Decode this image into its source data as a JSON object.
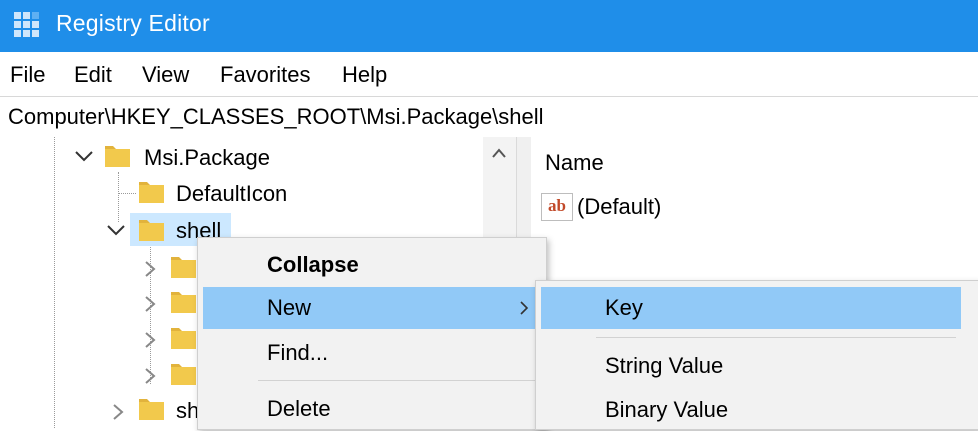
{
  "window": {
    "title": "Registry Editor",
    "icon": "registry-icon"
  },
  "menu": {
    "items": [
      "File",
      "Edit",
      "View",
      "Favorites",
      "Help"
    ]
  },
  "address": {
    "path": "Computer\\HKEY_CLASSES_ROOT\\Msi.Package\\shell"
  },
  "tree": {
    "nodes": [
      {
        "label": "Msi.Package",
        "expanded": true
      },
      {
        "label": "DefaultIcon",
        "expanded": false
      },
      {
        "label": "shell",
        "expanded": true,
        "selected": true
      },
      {
        "label": "",
        "expanded": false
      },
      {
        "label": "",
        "expanded": false
      },
      {
        "label": "",
        "expanded": false
      },
      {
        "label": "",
        "expanded": false
      },
      {
        "label": "sh",
        "expanded": false
      }
    ]
  },
  "values_pane": {
    "column_name": "Name",
    "rows": [
      {
        "icon": "ab-string-icon",
        "name": "(Default)"
      }
    ]
  },
  "context_menu": {
    "items": [
      {
        "label": "Collapse",
        "bold": true
      },
      {
        "label": "New",
        "submenu": true,
        "highlighted": true
      },
      {
        "label": "Find..."
      },
      {
        "label": "Delete"
      }
    ]
  },
  "submenu": {
    "items": [
      {
        "label": "Key",
        "highlighted": true
      },
      {
        "label": "String Value"
      },
      {
        "label": "Binary Value"
      }
    ]
  },
  "colors": {
    "titlebar": "#1f8ee9",
    "selection": "#cce8ff",
    "menu_highlight": "#91c9f7",
    "folder": "#f2c94c"
  }
}
